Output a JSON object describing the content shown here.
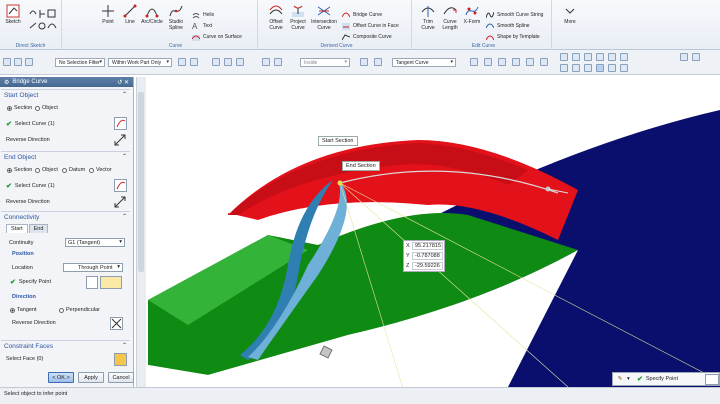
{
  "ribbon": {
    "groups": {
      "direct_sketch": "Direct Sketch",
      "curve": "Curve",
      "derived_curve": "Derived Curve",
      "edit_curve": "Edit Curve"
    },
    "tools": {
      "sketch": "Sketch",
      "point": "Point",
      "line": "Line",
      "arc_circle": "Arc/Circle",
      "studio_spline": "Studio\nSpline",
      "helix": "Helix",
      "text": "Text",
      "curve_on_surface": "Curve on Surface",
      "offset_curve": "Offset\nCurve",
      "project_curve": "Project\nCurve",
      "intersection_curve": "Intersection\nCurve",
      "bridge_curve": "Bridge Curve",
      "offset_curve_in_face": "Offset Curve in Face",
      "composite_curve": "Composite Curve",
      "trim_curve": "Trim\nCurve",
      "curve_length": "Curve\nLength",
      "x_form": "X-Form",
      "smooth_curve_string": "Smooth Curve String",
      "smooth_spline": "Smooth Spline",
      "shape_by_template": "Shape by Template",
      "more": "More"
    }
  },
  "toolbar": {
    "selection_filter": "No Selection Filter",
    "scope": "Within Work Part Only",
    "snap_filter": "Inside",
    "snap_target": "Tangent Curve"
  },
  "dialog": {
    "title": "Bridge Curve",
    "start_object": {
      "heading": "Start Object",
      "opt_section": "Section",
      "opt_object": "Object",
      "select_curve": "Select Curve (1)",
      "reverse": "Reverse Direction"
    },
    "end_object": {
      "heading": "End Object",
      "opt_section": "Section",
      "opt_object": "Object",
      "opt_datum": "Datum",
      "opt_vector": "Vector",
      "select_curve": "Select Curve (1)",
      "reverse": "Reverse Direction"
    },
    "connectivity": {
      "heading": "Connectivity",
      "tab_start": "Start",
      "tab_end": "End",
      "continuity_label": "Continuity",
      "continuity_value": "G1 (Tangent)",
      "position_heading": "Position",
      "location_label": "Location",
      "location_value": "Through Point",
      "specify_point": "Specify Point",
      "direction_heading": "Direction",
      "opt_tangent": "Tangent",
      "opt_perpendicular": "Perpendicular",
      "reverse": "Reverse Direction"
    },
    "constraint_faces": {
      "heading": "Constraint Faces",
      "select_face": "Select Face (0)"
    },
    "buttons": {
      "ok": "< OK >",
      "apply": "Apply",
      "cancel": "Cancel"
    }
  },
  "viewport": {
    "callout_start": "Start Section",
    "callout_end": "End Section",
    "coord": {
      "x_label": "X",
      "x": "95.217815",
      "y_label": "Y",
      "y": "-0.787088",
      "z_label": "Z",
      "z": "-29.59226"
    },
    "snap_label": "Specify Point"
  },
  "status": {
    "prompt": "Select object to infer point"
  },
  "colors": {
    "red_surface": "#e3111a",
    "green_surface": "#0f8a13",
    "navy_surface": "#0a0f6e",
    "blue_bridge": "#2f7fb3",
    "title_bar": "#456891"
  }
}
